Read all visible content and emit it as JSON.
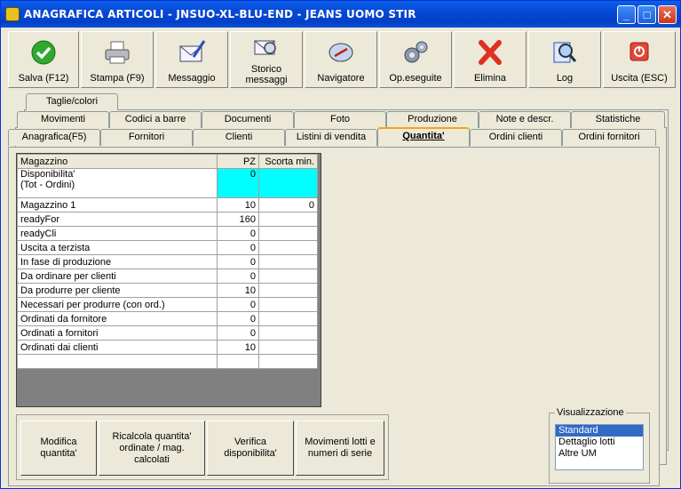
{
  "window": {
    "title": "ANAGRAFICA ARTICOLI - JNSUO-XL-BLU-END - JEANS UOMO STIR",
    "controls": {
      "minimize": "_",
      "maximize": "□",
      "close": "✕"
    }
  },
  "toolbar": {
    "buttons": [
      {
        "label": "Salva (F12)",
        "icon": "check-icon"
      },
      {
        "label": "Stampa (F9)",
        "icon": "printer-icon"
      },
      {
        "label": "Messaggio",
        "icon": "envelope-icon"
      },
      {
        "label": "Storico\nmessaggi",
        "icon": "envelope-search-icon"
      },
      {
        "label": "Navigatore",
        "icon": "compass-icon"
      },
      {
        "label": "Op.eseguite",
        "icon": "gears-icon"
      },
      {
        "label": "Elimina",
        "icon": "delete-icon"
      },
      {
        "label": "Log",
        "icon": "magnifier-icon"
      },
      {
        "label": "Uscita (ESC)",
        "icon": "exit-icon"
      }
    ]
  },
  "tabs": {
    "row1": [
      "Taglie/colori"
    ],
    "row2": [
      "Movimenti",
      "Codici a barre",
      "Documenti",
      "Foto",
      "Produzione",
      "Note e descr.",
      "Statistiche"
    ],
    "row3": [
      "Anagrafica(F5)",
      "Fornitori",
      "Clienti",
      "Listini di vendita",
      "Quantita'",
      "Ordini clienti",
      "Ordini fornitori"
    ],
    "active": "Quantita'"
  },
  "grid": {
    "headers": [
      "Magazzino",
      "PZ",
      "Scorta min."
    ],
    "rows": [
      {
        "label": "Disponibilita'\n (Tot - Ordini)",
        "pz": "0",
        "scorta": ""
      },
      {
        "label": "Magazzino 1",
        "pz": "10",
        "scorta": "0"
      },
      {
        "label": "readyFor",
        "pz": "160",
        "scorta": ""
      },
      {
        "label": "readyCli",
        "pz": "0",
        "scorta": ""
      },
      {
        "label": "Uscita a terzista",
        "pz": "0",
        "scorta": ""
      },
      {
        "label": "In fase di produzione",
        "pz": "0",
        "scorta": ""
      },
      {
        "label": "Da ordinare per clienti",
        "pz": "0",
        "scorta": ""
      },
      {
        "label": "Da produrre per cliente",
        "pz": "10",
        "scorta": ""
      },
      {
        "label": "Necessari per produrre (con ord.)",
        "pz": "0",
        "scorta": ""
      },
      {
        "label": "Ordinati da fornitore",
        "pz": "0",
        "scorta": ""
      },
      {
        "label": "Ordinati a fornitori",
        "pz": "0",
        "scorta": ""
      },
      {
        "label": "Ordinati dai clienti",
        "pz": "10",
        "scorta": ""
      }
    ]
  },
  "actions": {
    "modifica": "Modifica\nquantita'",
    "ricalcola": "Ricalcola quantita'\nordinate / mag.\ncalcolati",
    "verifica": "Verifica\ndisponibilita'",
    "movimenti": "Movimenti lotti e\nnumeri di serie"
  },
  "visualizzazione": {
    "legend": "Visualizzazione",
    "options": [
      "Standard",
      "Dettaglio lotti",
      "Altre UM"
    ],
    "selected": "Standard"
  },
  "colors": {
    "highlight_cell": "#00ffff",
    "selection": "#316ac5",
    "active_tab_accent": "#f2a41c"
  }
}
